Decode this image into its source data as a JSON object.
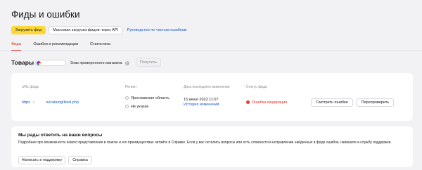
{
  "page": {
    "title": "Фиды и ошибки"
  },
  "actions": {
    "upload_feed": "Загрузить фид",
    "bulk_upload_api": "Массовая загрузка фидов через API",
    "faq_link": "Руководство по частым ошибкам"
  },
  "tabs": [
    {
      "label": "Фиды",
      "active": true
    },
    {
      "label": "Ошибки и рекомендации",
      "active": false
    },
    {
      "label": "Статистика",
      "active": false
    }
  ],
  "goods": {
    "title": "Товары",
    "verified_label": "Знак проверенного магазина",
    "info_icon": "?",
    "get_button": "Получить"
  },
  "feeds_table": {
    "headers": [
      "URL фида",
      "Регион",
      "Дата последнего изменения",
      "Статус фида"
    ],
    "row": {
      "url_prefix": "https",
      "url_path": "ru/catalog/feed.php",
      "regions": [
        "Ярославская область",
        "Не указан"
      ],
      "date": "15 июня 2022 11:07",
      "history_link": "История изменений",
      "status": "Ошибка модерации",
      "status_icon": "!",
      "view_errors": "Смотреть ошибки",
      "recheck": "Перепроверить"
    }
  },
  "help": {
    "title": "Мы рады ответить на ваши вопросы",
    "text": "Подробнее про возможности нового представления в поиске и его преимуществах читайте в Справке. Если у вас остались вопросы или есть сложности в исправлении найденных в фиде ошибок, напишите в службу поддержки.",
    "support_button": "Написать в поддержку",
    "help_button": "Справка"
  },
  "colors": {
    "accent_yellow": "#fdd83a",
    "link_blue": "#1d59c9",
    "error_red": "#e53322",
    "background": "#f2f2f5"
  }
}
